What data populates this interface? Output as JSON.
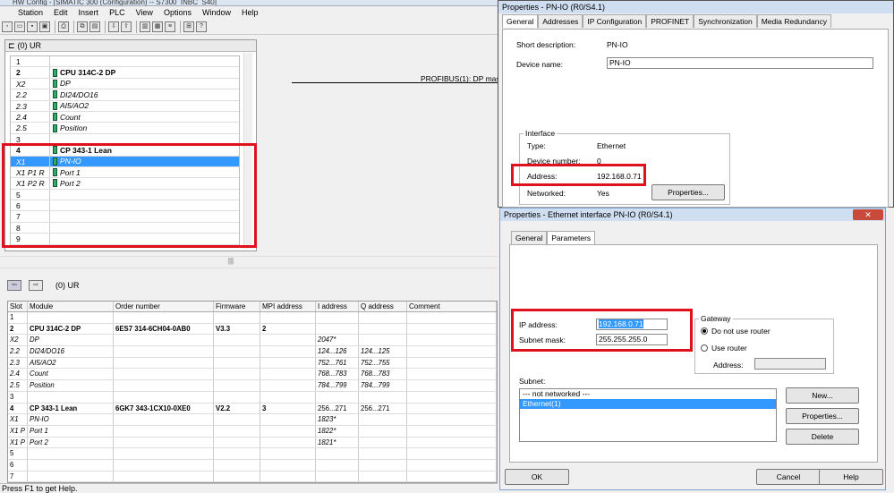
{
  "window": {
    "title": "HW Config - [SIMATIC 300 (Configuration) -- S7300_INBC_S40]"
  },
  "menu": [
    "Station",
    "Edit",
    "Insert",
    "PLC",
    "View",
    "Options",
    "Window",
    "Help"
  ],
  "rack": {
    "title": "(0) UR",
    "rows": [
      {
        "slot": "1",
        "module": "",
        "style": "plain"
      },
      {
        "slot": "2",
        "module": "CPU 314C-2 DP",
        "style": "bold"
      },
      {
        "slot": "X2",
        "module": "DP",
        "style": "italic"
      },
      {
        "slot": "2.2",
        "module": "DI24/DO16",
        "style": "italic"
      },
      {
        "slot": "2.3",
        "module": "AI5/AO2",
        "style": "italic"
      },
      {
        "slot": "2.4",
        "module": "Count",
        "style": "italic"
      },
      {
        "slot": "2.5",
        "module": "Position",
        "style": "italic"
      },
      {
        "slot": "3",
        "module": "",
        "style": "plain"
      },
      {
        "slot": "4",
        "module": "CP 343-1 Lean",
        "style": "bold"
      },
      {
        "slot": "X1",
        "module": "PN-IO",
        "style": "selected"
      },
      {
        "slot": "X1 P1 R",
        "module": "Port 1",
        "style": "italic"
      },
      {
        "slot": "X1 P2 R",
        "module": "Port 2",
        "style": "italic"
      },
      {
        "slot": "5",
        "module": "",
        "style": "plain"
      },
      {
        "slot": "6",
        "module": "",
        "style": "plain"
      },
      {
        "slot": "7",
        "module": "",
        "style": "plain"
      },
      {
        "slot": "8",
        "module": "",
        "style": "plain"
      },
      {
        "slot": "9",
        "module": "",
        "style": "plain"
      }
    ]
  },
  "network": {
    "label": "PROFIBUS(1): DP mas"
  },
  "detail": {
    "title": "(0)   UR",
    "headers": [
      "Slot",
      "Module",
      "Order number",
      "Firmware",
      "MPI address",
      "I address",
      "Q address",
      "Comment"
    ],
    "rows": [
      [
        "1",
        "",
        "",
        "",
        "",
        "",
        "",
        ""
      ],
      [
        "2",
        "CPU 314C-2 DP",
        "6ES7 314-6CH04-0AB0",
        "V3.3",
        "2",
        "",
        "",
        ""
      ],
      [
        "X2",
        "DP",
        "",
        "",
        "",
        "2047*",
        "",
        ""
      ],
      [
        "2.2",
        "DI24/DO16",
        "",
        "",
        "",
        "124...126",
        "124...125",
        ""
      ],
      [
        "2.3",
        "AI5/AO2",
        "",
        "",
        "",
        "752...761",
        "752...755",
        ""
      ],
      [
        "2.4",
        "Count",
        "",
        "",
        "",
        "768...783",
        "768...783",
        ""
      ],
      [
        "2.5",
        "Position",
        "",
        "",
        "",
        "784...799",
        "784...799",
        ""
      ],
      [
        "3",
        "",
        "",
        "",
        "",
        "",
        "",
        ""
      ],
      [
        "4",
        "CP 343-1 Lean",
        "6GK7 343-1CX10-0XE0",
        "V2.2",
        "3",
        "256...271",
        "256...271",
        ""
      ],
      [
        "X1",
        "PN-IO",
        "",
        "",
        "",
        "1823*",
        "",
        ""
      ],
      [
        "X1 P",
        "Port 1",
        "",
        "",
        "",
        "1822*",
        "",
        ""
      ],
      [
        "X1 P",
        "Port 2",
        "",
        "",
        "",
        "1821*",
        "",
        ""
      ],
      [
        "5",
        "",
        "",
        "",
        "",
        "",
        "",
        ""
      ],
      [
        "6",
        "",
        "",
        "",
        "",
        "",
        "",
        ""
      ],
      [
        "7",
        "",
        "",
        "",
        "",
        "",
        "",
        ""
      ]
    ]
  },
  "status": "Press F1 to get Help.",
  "props1": {
    "title": "Properties - PN-IO (R0/S4.1)",
    "tabs": [
      "General",
      "Addresses",
      "IP Configuration",
      "PROFINET",
      "Synchronization",
      "Media Redundancy"
    ],
    "short_desc_label": "Short description:",
    "short_desc_value": "PN-IO",
    "device_name_label": "Device name:",
    "device_name_value": "PN-IO",
    "interface_group": "Interface",
    "type_label": "Type:",
    "type_value": "Ethernet",
    "device_number_label": "Device number:",
    "device_number_value": "0",
    "address_label": "Address:",
    "address_value": "192.168.0.71",
    "networked_label": "Networked:",
    "networked_value": "Yes",
    "properties_btn": "Properties..."
  },
  "props2": {
    "title": "Properties - Ethernet interface  PN-IO (R0/S4.1)",
    "tabs": [
      "General",
      "Parameters"
    ],
    "ip_label": "IP address:",
    "ip_value": "192.168.0.71",
    "mask_label": "Subnet mask:",
    "mask_value": "255.255.255.0",
    "gateway_group": "Gateway",
    "radio_no_router": "Do not use router",
    "radio_use_router": "Use router",
    "gw_address_label": "Address:",
    "subnet_label": "Subnet:",
    "subnet_items": [
      "--- not networked ---",
      "Ethernet(1)"
    ],
    "btn_new": "New...",
    "btn_props": "Properties...",
    "btn_delete": "Delete",
    "btn_ok": "OK",
    "btn_cancel": "Cancel",
    "btn_help": "Help"
  },
  "colors": {
    "highlight": "#e0111d",
    "selection": "#3399ff"
  }
}
